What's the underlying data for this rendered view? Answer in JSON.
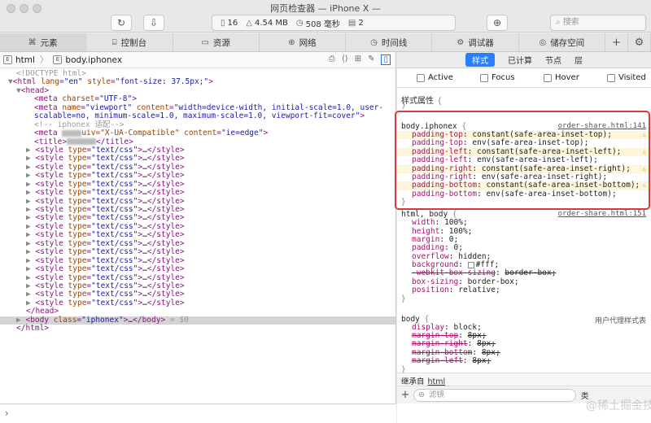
{
  "window": {
    "title": "网页检查器 — iPhone X —",
    "toolbar": {
      "reload_icon": "reload-icon",
      "download_icon": "download-icon",
      "target_icon": "crosshair-icon",
      "stats": [
        {
          "icon": "file-icon",
          "value": "16"
        },
        {
          "icon": "weight-icon",
          "value": "4.54 MB"
        },
        {
          "icon": "clock-icon",
          "value": "508 毫秒"
        },
        {
          "icon": "log-icon",
          "value": "2"
        }
      ],
      "search_placeholder": "搜索"
    }
  },
  "tabs": [
    {
      "label": "元素",
      "icon": "elements-icon",
      "active": true
    },
    {
      "label": "控制台",
      "icon": "console-icon",
      "active": false
    },
    {
      "label": "资源",
      "icon": "resources-icon",
      "active": false
    },
    {
      "label": "网络",
      "icon": "network-icon",
      "active": false
    },
    {
      "label": "时间线",
      "icon": "timeline-icon",
      "active": false
    },
    {
      "label": "调试器",
      "icon": "debugger-icon",
      "active": false
    },
    {
      "label": "储存空间",
      "icon": "storage-icon",
      "active": false
    }
  ],
  "breadcrumb": [
    {
      "icon": "E",
      "label": "html"
    },
    {
      "icon": "E",
      "label": "body.iphonex"
    }
  ],
  "dom": {
    "doctype": "<!DOCTYPE html>",
    "html_open": {
      "tag": "html",
      "attrs": [
        [
          "lang",
          "en"
        ],
        [
          "style",
          "font-size: 37.5px;"
        ]
      ]
    },
    "head_open": "<head>",
    "meta_charset": {
      "attr": "charset",
      "value": "UTF-8"
    },
    "meta_viewport": {
      "name": "viewport",
      "content_line1": "width=device-width, initial-scale=1.0, user-",
      "content_line2": "scalable=no, minimum-scale=1.0, maximum-scale=1.0, viewport-fit=cover"
    },
    "comment": "<!-- iphonex 适配-->",
    "meta_xua": {
      "suffix": "uiv=\"X-UA-Compatible\"",
      "content": "ie=edge"
    },
    "title_end": "</title>",
    "style_line": {
      "tag": "style",
      "type": "text/css",
      "ellipsis": "…",
      "close": "</style>"
    },
    "style_count": 19,
    "head_close": "</head>",
    "body_line": {
      "tag": "body",
      "class": "iphonex",
      "ellipsis": "…",
      "close": "</body>",
      "ref": "= $0"
    },
    "html_close": "</html>"
  },
  "styles": {
    "tabs": [
      "样式",
      "已计算",
      "节点",
      "层"
    ],
    "active_tab": "样式",
    "pseudo": [
      "Active",
      "Focus",
      "Hover",
      "Visited"
    ],
    "section_title": "样式属性",
    "rules": [
      {
        "selector": "body.iphonex",
        "source": "order-share.html:141",
        "decls": [
          {
            "prop": "padding-top",
            "value": "constant(safe-area-inset-top);",
            "warn": true
          },
          {
            "prop": "padding-top",
            "value": "env(safe-area-inset-top);",
            "warn": false
          },
          {
            "prop": "padding-left",
            "value": "constant(safe-area-inset-left);",
            "warn": true
          },
          {
            "prop": "padding-left",
            "value": "env(safe-area-inset-left);",
            "warn": false
          },
          {
            "prop": "padding-right",
            "value": "constant(safe-area-inset-right);",
            "warn": true
          },
          {
            "prop": "padding-right",
            "value": "env(safe-area-inset-right);",
            "warn": false
          },
          {
            "prop": "padding-bottom",
            "value": "constant(safe-area-inset-bottom);",
            "warn": true
          },
          {
            "prop": "padding-bottom",
            "value": "env(safe-area-inset-bottom);",
            "warn": false
          }
        ]
      },
      {
        "selector": "html, body",
        "source": "order-share.html:151",
        "decls": [
          {
            "prop": "width",
            "value": "100%;"
          },
          {
            "prop": "height",
            "value": "100%;"
          },
          {
            "prop": "margin",
            "value": "0;"
          },
          {
            "prop": "padding",
            "value": "0;"
          },
          {
            "prop": "overflow",
            "value": "hidden;"
          },
          {
            "prop": "background",
            "value": "#fff;",
            "swatch": "#ffffff"
          },
          {
            "prop": "-webkit-box-sizing",
            "value": "border-box;",
            "strike": true
          },
          {
            "prop": "box-sizing",
            "value": "border-box;"
          },
          {
            "prop": "position",
            "value": "relative;"
          }
        ]
      },
      {
        "selector": "body",
        "source": "用户代理样式表",
        "decls": [
          {
            "prop": "display",
            "value": "block;"
          },
          {
            "prop": "margin-top",
            "value": "8px;",
            "strike": true
          },
          {
            "prop": "margin-right",
            "value": "8px;",
            "strike": true
          },
          {
            "prop": "margin-bottom",
            "value": "8px;",
            "strike": true
          },
          {
            "prop": "margin-left",
            "value": "8px;",
            "strike": true
          }
        ]
      }
    ],
    "inherited_label": "继承自",
    "inherited_from": "html",
    "filter_placeholder": "滤镜",
    "filter_more": "类"
  },
  "watermark": "@稀土掘金技术社区",
  "accent_color": "#2a7fff",
  "highlight_color": "#d83a3a"
}
